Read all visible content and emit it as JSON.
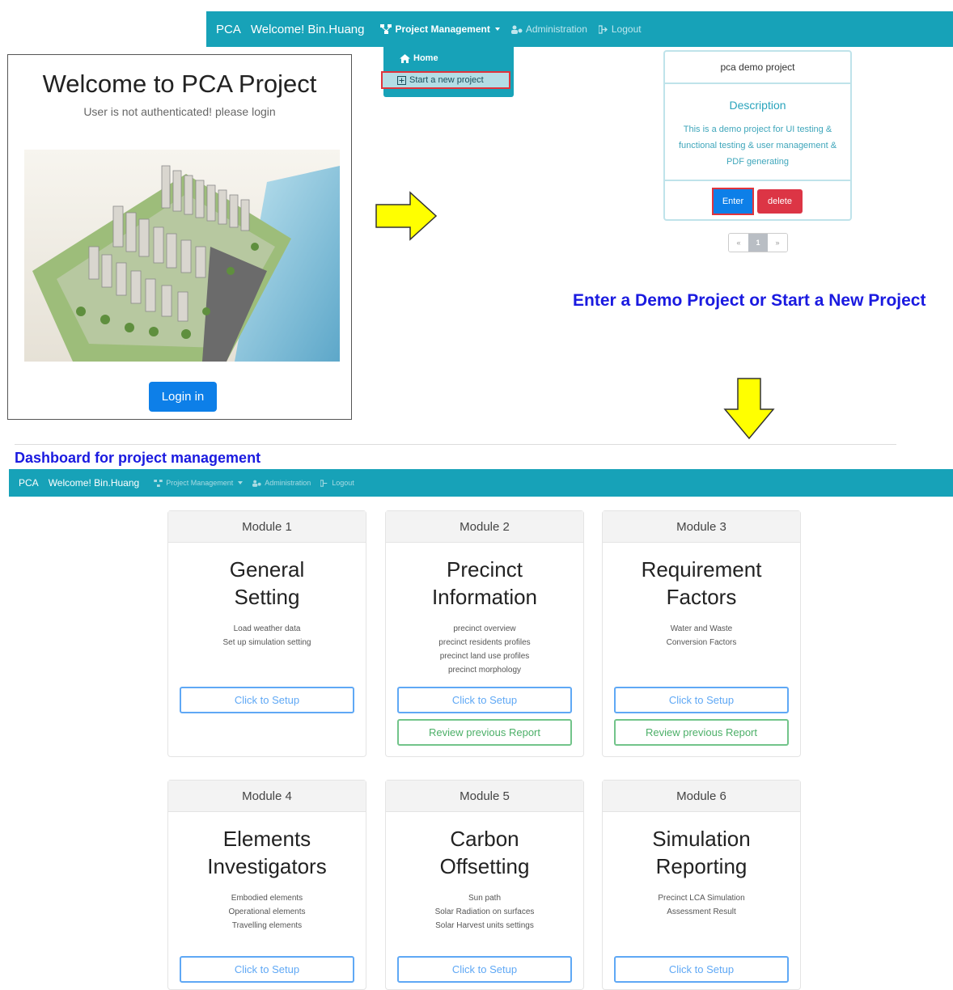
{
  "top_nav": {
    "brand": "PCA",
    "welcome": "Welcome! Bin.Huang",
    "project_management": "Project Management",
    "administration": "Administration",
    "logout": "Logout"
  },
  "dropdown": {
    "home": "Home",
    "start_new": "Start a new project"
  },
  "login": {
    "title": "Welcome to PCA Project",
    "subtitle": "User is not authenticated! please login",
    "button": "Login in"
  },
  "project_card": {
    "name": "pca demo project",
    "description_title": "Description",
    "description": "This is a demo project for UI testing & functional testing & user management & PDF generating",
    "enter": "Enter",
    "delete": "delete"
  },
  "pagination": {
    "prev": "«",
    "current": "1",
    "next": "»"
  },
  "captions": {
    "enter_demo": "Enter a Demo Project or Start a New Project",
    "dashboard": "Dashboard for project management"
  },
  "bottom_nav": {
    "brand": "PCA",
    "welcome": "Welcome! Bin.Huang",
    "project_management": "Project Management",
    "administration": "Administration",
    "logout": "Logout"
  },
  "modules": [
    {
      "header": "Module 1",
      "title_line1": "General",
      "title_line2": "Setting",
      "lines": [
        "Load weather data",
        "Set up simulation setting"
      ],
      "setup": "Click to Setup",
      "review": ""
    },
    {
      "header": "Module 2",
      "title_line1": "Precinct",
      "title_line2": "Information",
      "lines": [
        "precinct overview",
        "precinct residents profiles",
        "precinct land use profiles",
        "precinct morphology"
      ],
      "setup": "Click to Setup",
      "review": "Review previous Report"
    },
    {
      "header": "Module 3",
      "title_line1": "Requirement",
      "title_line2": "Factors",
      "lines": [
        "Water and Waste",
        "Conversion Factors"
      ],
      "setup": "Click to Setup",
      "review": "Review previous Report"
    },
    {
      "header": "Module 4",
      "title_line1": "Elements",
      "title_line2": "Investigators",
      "lines": [
        "Embodied elements",
        "Operational elements",
        "Travelling elements"
      ],
      "setup": "Click to Setup",
      "review": ""
    },
    {
      "header": "Module 5",
      "title_line1": "Carbon",
      "title_line2": "Offsetting",
      "lines": [
        "Sun path",
        "Solar Radiation on surfaces",
        "Solar Harvest units settings"
      ],
      "setup": "Click to Setup",
      "review": ""
    },
    {
      "header": "Module 6",
      "title_line1": "Simulation",
      "title_line2": "Reporting",
      "lines": [
        "Precinct LCA Simulation",
        "Assessment Result"
      ],
      "setup": "Click to Setup",
      "review": ""
    }
  ],
  "colors": {
    "navbar": "#17a2b8",
    "primary": "#0d7fe8",
    "danger": "#dc3545",
    "caption": "#1a1ae0",
    "arrow": "#ffff00"
  }
}
